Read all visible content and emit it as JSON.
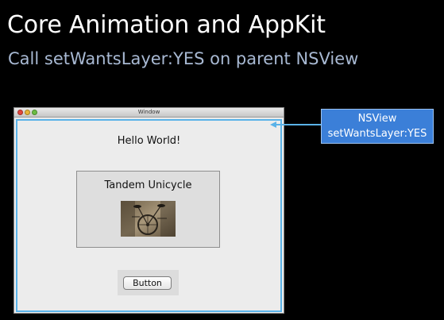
{
  "slide": {
    "title": "Core Animation and AppKit",
    "subtitle": "Call setWantsLayer:YES on parent NSView"
  },
  "window": {
    "title": "Window",
    "hello_label": "Hello World!",
    "box_title": "Tandem Unicycle",
    "button_label": "Button"
  },
  "callout": {
    "line1": "NSView",
    "line2": "setWantsLayer:YES"
  },
  "colors": {
    "background": "#000000",
    "subtitle": "#a8b9d3",
    "highlight": "#5ab2e8",
    "callout": "#3b7fd8"
  }
}
